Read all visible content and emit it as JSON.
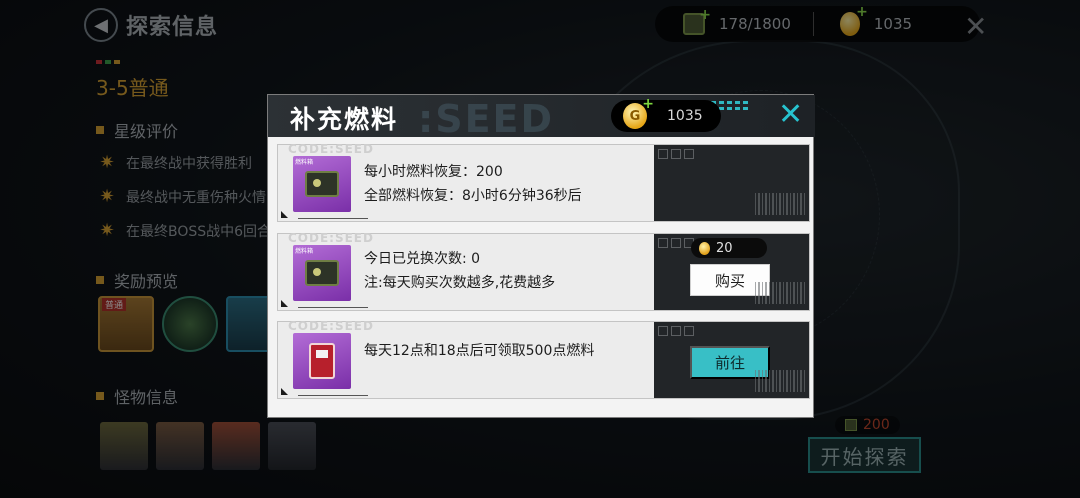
{
  "hud": {
    "title": "探索信息",
    "back_icon": "back-arrow-icon",
    "stage": "3-5普通",
    "fuel_display": "178/1800",
    "coin_display": "1035",
    "accent": "#d8a234"
  },
  "sections": {
    "rating": "星级评价",
    "rewards": "奖励预览",
    "monsters": "怪物信息"
  },
  "star_conditions": [
    "在最终战中获得胜利",
    "最终战中无重伤种火情",
    "在最终BOSS战中6回合"
  ],
  "reward_tag": "普通",
  "start": {
    "cost": "200",
    "label": "开始探索"
  },
  "modal": {
    "title": "补充燃料",
    "watermark": ":SEED",
    "coin_amount": "1035",
    "close_icon": "close-icon",
    "accent": "#38bfc6",
    "options": [
      {
        "code": "CODE:SEED",
        "thumb_tag": "燃料箱",
        "line1": "每小时燃料恢复：200",
        "line2": "全部燃料恢复：8小时6分钟36秒后"
      },
      {
        "code": "CODE:SEED",
        "thumb_tag": "燃料箱",
        "line1": "今日已兑换次数: 0",
        "line2": "注:每天购买次数越多,花费越多",
        "price": "20",
        "button": "购买"
      },
      {
        "code": "CODE:SEED",
        "line1": "每天12点和18点后可领取500点燃料",
        "button": "前往"
      }
    ]
  }
}
